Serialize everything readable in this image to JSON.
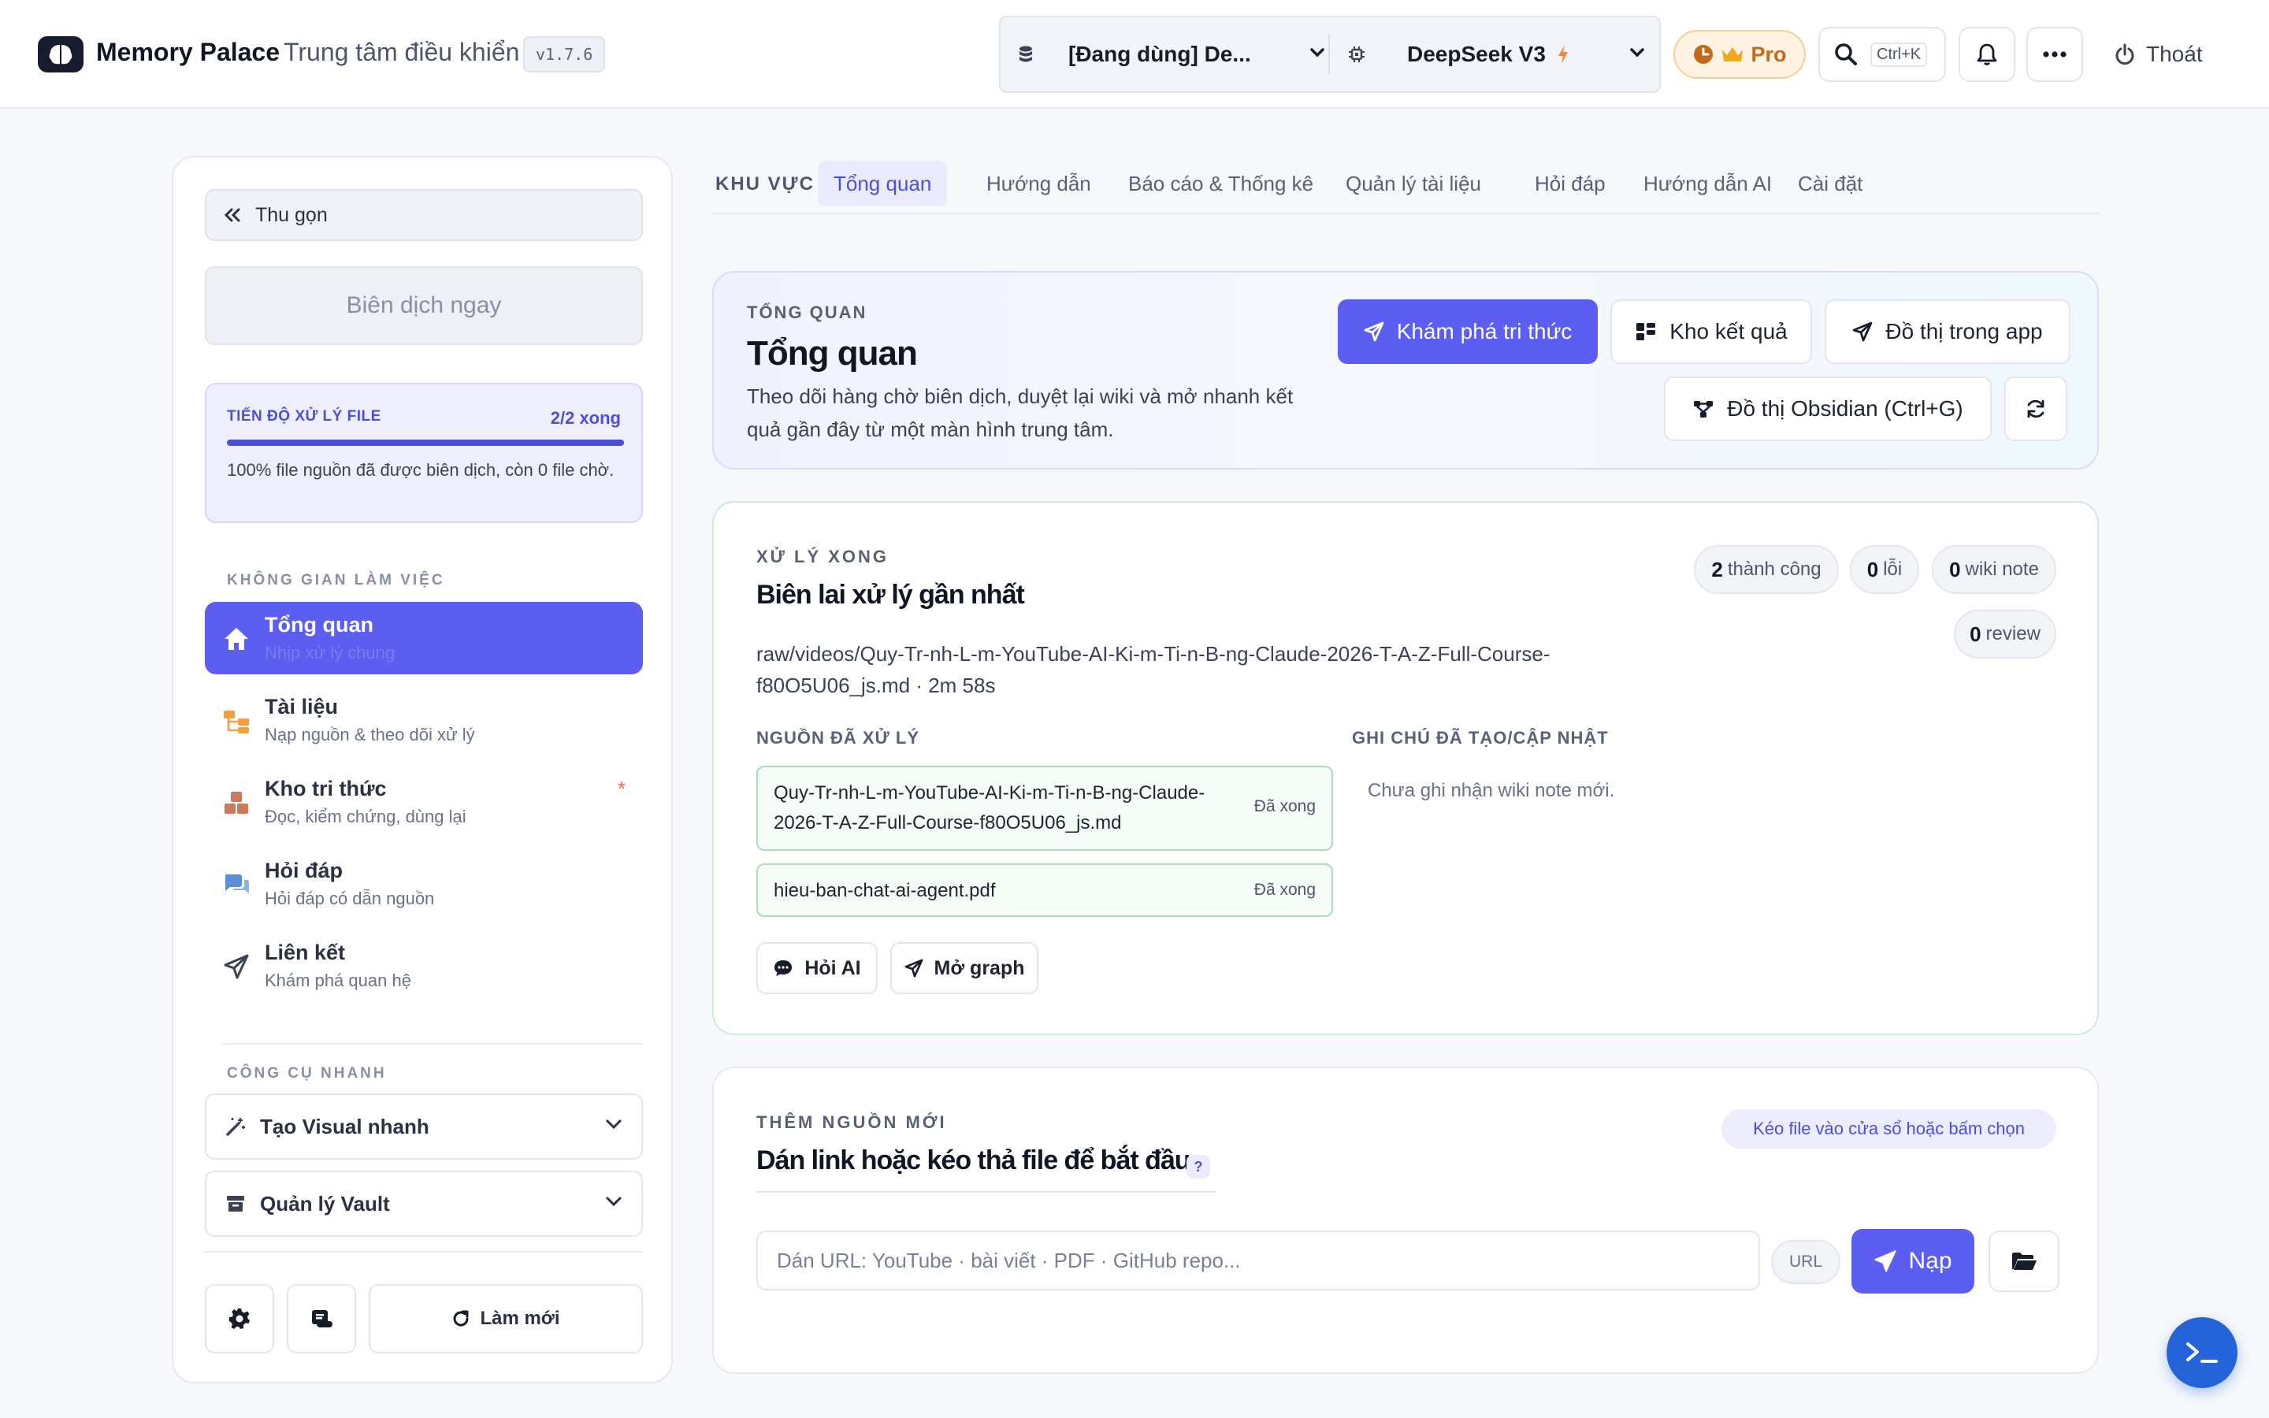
{
  "header": {
    "brand_name": "Memory Palace",
    "brand_sub": "Trung tâm điều khiển",
    "version": "v1.7.6",
    "vault_selector": "[Đang dùng] De...",
    "model_selector": "DeepSeek V3",
    "pro_label": "Pro",
    "search_shortcut": "Ctrl+K",
    "logout_label": "Thoát"
  },
  "sidebar": {
    "collapse_label": "Thu gọn",
    "compile_label": "Biên dịch ngay",
    "progress": {
      "title": "TIẾN ĐỘ XỬ LÝ FILE",
      "count": "2/2 xong",
      "fraction": 1.0,
      "description": "100% file nguồn đã được biên dịch, còn 0 file chờ."
    },
    "workspace_label": "KHÔNG GIAN LÀM VIỆC",
    "items": [
      {
        "title": "Tổng quan",
        "subtitle": "Nhịp xử lý chung",
        "icon": "home-icon",
        "active": true
      },
      {
        "title": "Tài liệu",
        "subtitle": "Nạp nguồn & theo dõi xử lý",
        "icon": "folder-tree-icon"
      },
      {
        "title": "Kho tri thức",
        "subtitle": "Đọc, kiểm chứng, dùng lại",
        "icon": "boxes-icon",
        "star": "*"
      },
      {
        "title": "Hỏi đáp",
        "subtitle": "Hỏi đáp có dẫn nguồn",
        "icon": "chat-bubbles-icon"
      },
      {
        "title": "Liên kết",
        "subtitle": "Khám phá quan hệ",
        "icon": "paper-plane-icon"
      }
    ],
    "quick_tools_label": "CÔNG CỤ NHANH",
    "tools": [
      {
        "label": "Tạo Visual nhanh",
        "icon": "magic-wand-icon"
      },
      {
        "label": "Quản lý Vault",
        "icon": "archive-icon"
      }
    ],
    "refresh_label": "Làm mới"
  },
  "tabs": {
    "section_label": "KHU VỰC",
    "items": [
      "Tổng quan",
      "Hướng dẫn",
      "Báo cáo & Thống kê",
      "Quản lý tài liệu",
      "Hỏi đáp",
      "Hướng dẫn AI",
      "Cài đặt"
    ],
    "active_index": 0
  },
  "overview": {
    "kicker": "TỔNG QUAN",
    "title": "Tổng quan",
    "description": "Theo dõi hàng chờ biên dịch, duyệt lại wiki và mở nhanh kết quả gần đây từ một màn hình trung tâm.",
    "explore_label": "Khám phá tri thức",
    "results_label": "Kho kết quả",
    "graph_label": "Đồ thị trong app",
    "obsidian_label": "Đồ thị Obsidian (Ctrl+G)"
  },
  "receipt": {
    "kicker": "XỬ LÝ XONG",
    "title": "Biên lai xử lý gần nhất",
    "stats": [
      {
        "value": "2",
        "label": "thành công"
      },
      {
        "value": "0",
        "label": "lỗi"
      },
      {
        "value": "0",
        "label": "wiki note"
      },
      {
        "value": "0",
        "label": "review"
      }
    ],
    "path": "raw/videos/Quy-Tr-nh-L-m-YouTube-AI-Ki-m-Ti-n-B-ng-Claude-2026-T-A-Z-Full-Course-f80O5U06_js.md · 2m 58s",
    "sources_title": "NGUỒN ĐÃ XỬ LÝ",
    "notes_title": "GHI CHÚ ĐÃ TẠO/CẬP NHẬT",
    "sources": [
      {
        "name": "Quy-Tr-nh-L-m-YouTube-AI-Ki-m-Ti-n-B-ng-Claude-2026-T-A-Z-Full-Course-f80O5U06_js.md",
        "status": "Đã xong"
      },
      {
        "name": "hieu-ban-chat-ai-agent.pdf",
        "status": "Đã xong"
      }
    ],
    "notes_empty": "Chưa ghi nhận wiki note mới.",
    "ask_ai_label": "Hỏi AI",
    "open_graph_label": "Mở graph"
  },
  "add_source": {
    "kicker": "THÊM NGUỒN MỚI",
    "title": "Dán link hoặc kéo thả file để bắt đầu",
    "help": "?",
    "drop_hint": "Kéo file vào cửa sổ hoặc bấm chọn",
    "placeholder": "Dán URL: YouTube · bài viết · PDF · GitHub repo...",
    "url_tag": "URL",
    "load_label": "Nạp"
  },
  "colors": {
    "accent": "#5b5ef0",
    "pro": "#c2691a",
    "success_border": "#a9ddbb",
    "fab": "#2563d8"
  }
}
